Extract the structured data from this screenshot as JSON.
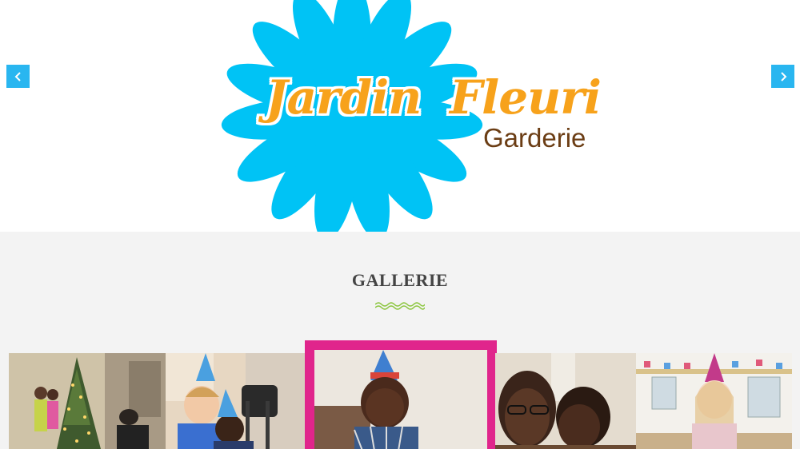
{
  "slider": {
    "prev_icon": "chevron-left-icon",
    "next_icon": "chevron-right-icon",
    "accent_color": "#29b6f0"
  },
  "logo": {
    "word1": "Jardin",
    "word2": "Fleuri",
    "subtitle": "Garderie",
    "flower_color": "#00c3f5",
    "title_color": "#f7a21b",
    "subtitle_color": "#6b3d14"
  },
  "gallery": {
    "title": "GALLERIE",
    "divider_color": "#8cc63f",
    "featured_border_color": "#e0258c",
    "photos": [
      {
        "scene": "children-by-christmas-tree"
      },
      {
        "scene": "children-party-hats"
      },
      {
        "scene": "boy-party-hat",
        "featured": true
      },
      {
        "scene": "children-hugging"
      },
      {
        "scene": "girl-party-hat-classroom"
      }
    ]
  }
}
